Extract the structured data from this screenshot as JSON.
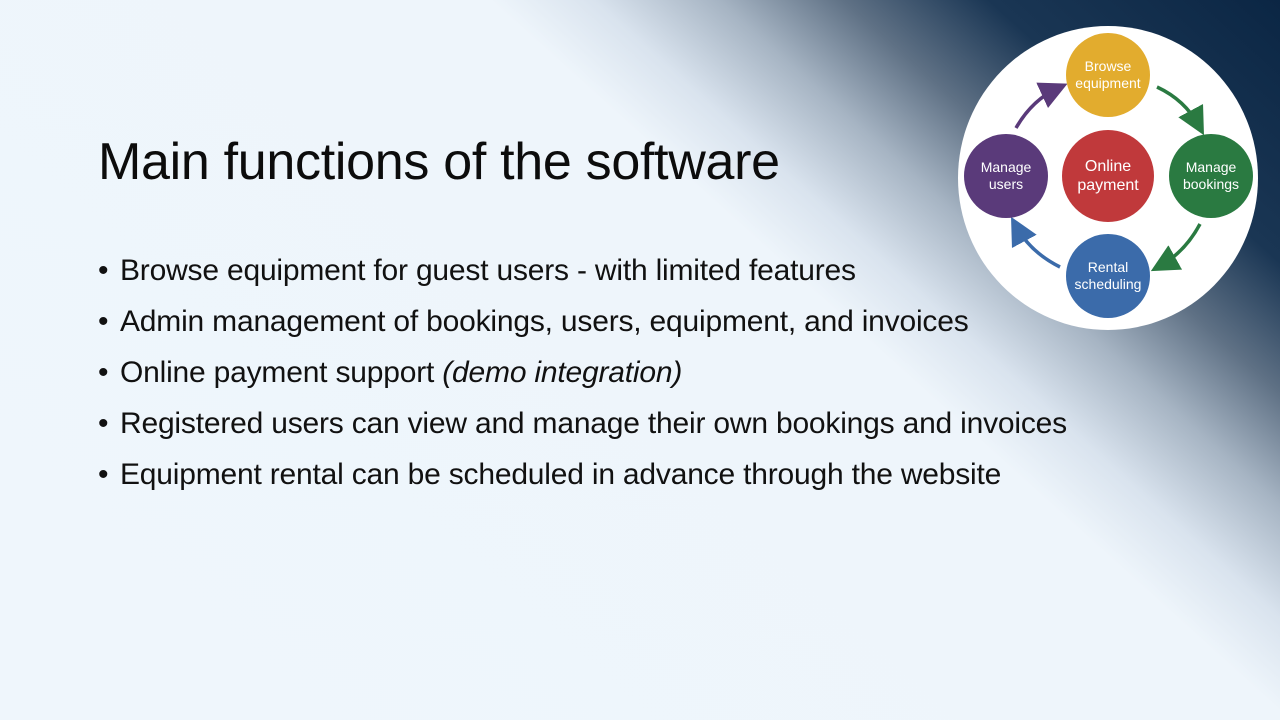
{
  "slide": {
    "title": "Main functions of the software",
    "bullets": [
      {
        "text": "Browse equipment for guest users - with limited features",
        "note": ""
      },
      {
        "text": "Admin management of bookings, users, equipment, and invoices",
        "note": ""
      },
      {
        "text": "Online payment support ",
        "note": "(demo integration)"
      },
      {
        "text": "Registered users can view and manage their own bookings and invoices",
        "note": ""
      },
      {
        "text": "Equipment rental can be scheduled in advance through the website",
        "note": ""
      }
    ],
    "bullet_symbol": "•"
  },
  "cycle": {
    "nodes": {
      "browse": "Browse\nequipment",
      "bookings": "Manage\nbookings",
      "rental": "Rental\nscheduling",
      "users": "Manage\nusers",
      "payment": "Online\npayment"
    },
    "colors": {
      "browse": "#e2ac2e",
      "bookings": "#2a7a41",
      "rental": "#3b6baa",
      "users": "#5a3a7a",
      "payment": "#c0393b"
    }
  }
}
